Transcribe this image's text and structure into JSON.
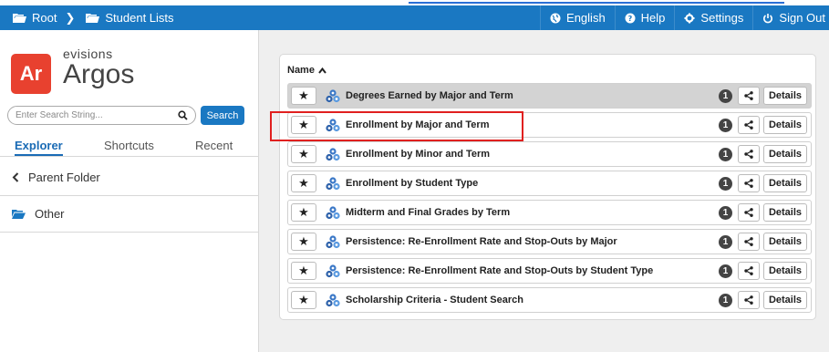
{
  "topbar": {
    "breadcrumbs": [
      {
        "label": "Root",
        "icon": "folder-icon"
      },
      {
        "label": "Student Lists",
        "icon": "folder-icon"
      }
    ],
    "actions": [
      {
        "label": "English",
        "icon": "globe-icon"
      },
      {
        "label": "Help",
        "icon": "help-icon"
      },
      {
        "label": "Settings",
        "icon": "gear-icon"
      },
      {
        "label": "Sign Out",
        "icon": "power-icon"
      }
    ],
    "color": "#1a78c2"
  },
  "logo": {
    "badge": "Ar",
    "sub": "evisions",
    "main": "Argos",
    "badge_color": "#e8412f"
  },
  "search": {
    "placeholder": "Enter Search String...",
    "button": "Search"
  },
  "tabs": [
    "Explorer",
    "Shortcuts",
    "Recent"
  ],
  "nav": {
    "parent": "Parent Folder",
    "other": "Other"
  },
  "list": {
    "header": "Name",
    "details_label": "Details",
    "items": [
      {
        "label": "Degrees Earned by Major and Term",
        "count": "1"
      },
      {
        "label": "Enrollment by Major and Term",
        "count": "1"
      },
      {
        "label": "Enrollment by Minor and Term",
        "count": "1"
      },
      {
        "label": "Enrollment by Student Type",
        "count": "1"
      },
      {
        "label": "Midterm and Final Grades by Term",
        "count": "1"
      },
      {
        "label": "Persistence: Re-Enrollment Rate and Stop-Outs by Major",
        "count": "1"
      },
      {
        "label": "Persistence: Re-Enrollment Rate and Stop-Outs by Student Type",
        "count": "1"
      },
      {
        "label": "Scholarship Criteria - Student Search",
        "count": "1"
      }
    ]
  }
}
